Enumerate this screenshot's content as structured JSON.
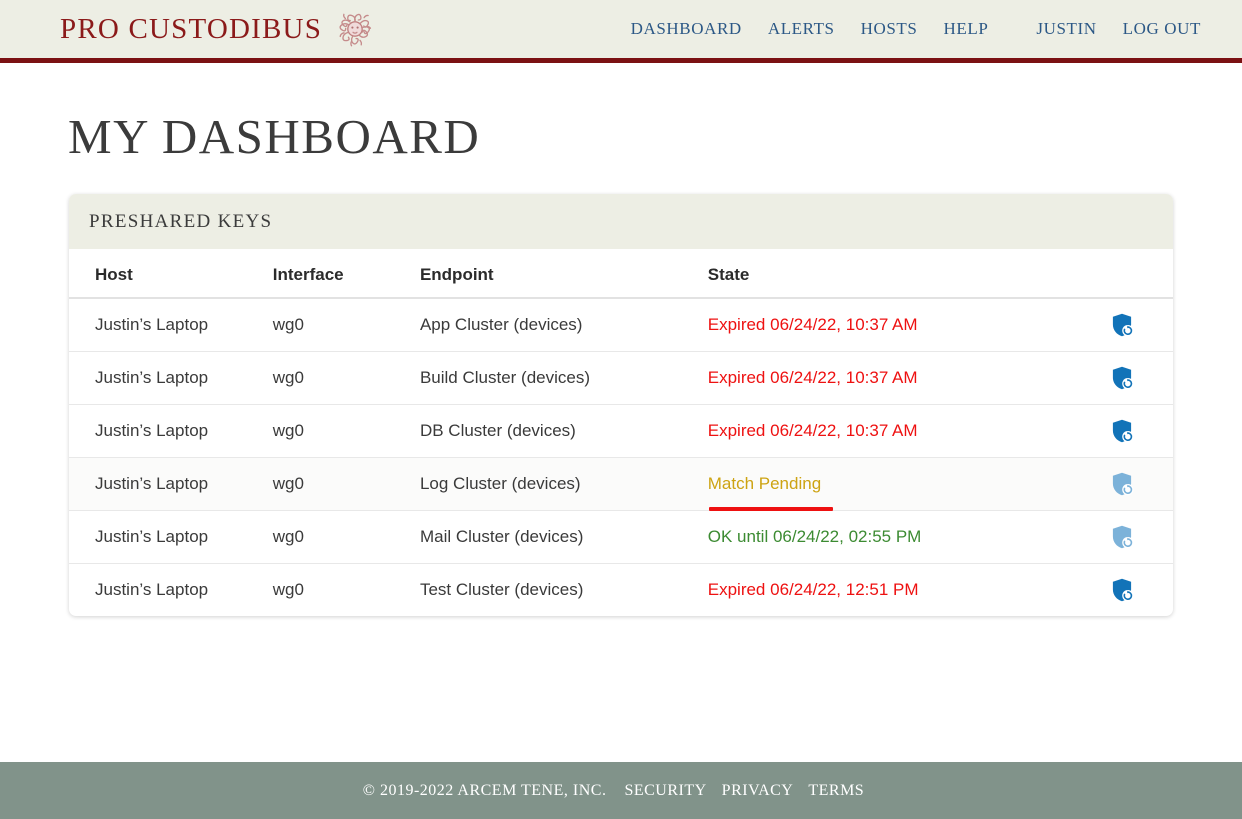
{
  "header": {
    "brand_name": "Pro Custodibus",
    "logo_icon": "medusa-head-icon",
    "accent_color": "#7b1113",
    "background": "#edeee4",
    "nav": [
      {
        "label": "Dashboard",
        "name": "dashboard"
      },
      {
        "label": "Alerts",
        "name": "alerts"
      },
      {
        "label": "Hosts",
        "name": "hosts"
      },
      {
        "label": "Help",
        "name": "help"
      }
    ],
    "account": [
      {
        "label": "Justin",
        "name": "user"
      },
      {
        "label": "Log Out",
        "name": "logout"
      }
    ]
  },
  "main": {
    "page_title": "My Dashboard",
    "card": {
      "title": "Preshared Keys",
      "columns": [
        "Host",
        "Interface",
        "Endpoint",
        "State"
      ],
      "rows": [
        {
          "host": "Justin’s Laptop",
          "interface": "wg0",
          "endpoint": "App Cluster (devices)",
          "state": "Expired 06/24/22, 10:37 AM",
          "state_kind": "expired",
          "icon": "shield-refresh-icon",
          "icon_color": "#1273b8",
          "highlighted": false,
          "progress": false
        },
        {
          "host": "Justin’s Laptop",
          "interface": "wg0",
          "endpoint": "Build Cluster (devices)",
          "state": "Expired 06/24/22, 10:37 AM",
          "state_kind": "expired",
          "icon": "shield-refresh-icon",
          "icon_color": "#1273b8",
          "highlighted": false,
          "progress": false
        },
        {
          "host": "Justin’s Laptop",
          "interface": "wg0",
          "endpoint": "DB Cluster (devices)",
          "state": "Expired 06/24/22, 10:37 AM",
          "state_kind": "expired",
          "icon": "shield-refresh-icon",
          "icon_color": "#1273b8",
          "highlighted": false,
          "progress": false
        },
        {
          "host": "Justin’s Laptop",
          "interface": "wg0",
          "endpoint": "Log Cluster (devices)",
          "state": "Match Pending",
          "state_kind": "pending",
          "icon": "shield-refresh-icon",
          "icon_color": "#7cb2d9",
          "highlighted": true,
          "progress": true
        },
        {
          "host": "Justin’s Laptop",
          "interface": "wg0",
          "endpoint": "Mail Cluster (devices)",
          "state": "OK until 06/24/22, 02:55 PM",
          "state_kind": "ok",
          "icon": "shield-refresh-icon",
          "icon_color": "#7cb2d9",
          "highlighted": false,
          "progress": false
        },
        {
          "host": "Justin’s Laptop",
          "interface": "wg0",
          "endpoint": "Test Cluster (devices)",
          "state": "Expired 06/24/22, 12:51 PM",
          "state_kind": "expired",
          "icon": "shield-refresh-icon",
          "icon_color": "#1273b8",
          "highlighted": false,
          "progress": false
        }
      ]
    }
  },
  "footer": {
    "background": "#81938a",
    "copyright": "© 2019-2022 Arcem Tene, Inc.",
    "links": [
      {
        "label": "Security",
        "name": "security"
      },
      {
        "label": "Privacy",
        "name": "privacy"
      },
      {
        "label": "Terms",
        "name": "terms"
      }
    ]
  },
  "colors": {
    "expired": "#ee1111",
    "ok": "#3c8b32",
    "pending": "#cda312",
    "brand": "#8b1a1a",
    "nav_link": "#2c5886"
  }
}
